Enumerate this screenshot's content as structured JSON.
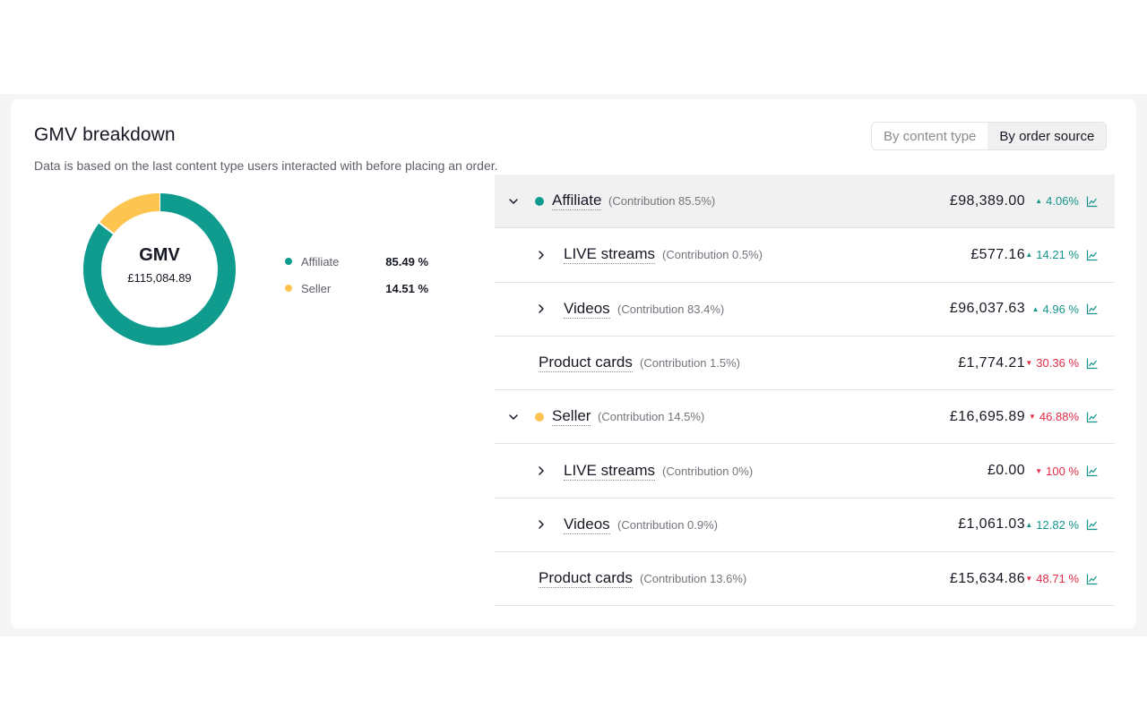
{
  "header": {
    "title": "GMV breakdown",
    "subtitle": "Data is based on the last content type users interacted with before placing an order."
  },
  "toggle": {
    "options": [
      "By content type",
      "By order source"
    ],
    "selected": "By order source"
  },
  "colors": {
    "affiliate": "#0f9b8e",
    "seller": "#fec450",
    "up": "#14948b",
    "down": "#e22b47"
  },
  "donut": {
    "title": "GMV",
    "total": "£115,084.89"
  },
  "chart_data": {
    "type": "pie",
    "categories": [
      "Affiliate",
      "Seller"
    ],
    "values": [
      85.49,
      14.51
    ],
    "title": "GMV"
  },
  "legend": [
    {
      "label": "Affiliate",
      "pct": "85.49 %"
    },
    {
      "label": "Seller",
      "pct": "14.51 %"
    }
  ],
  "rows": [
    {
      "name": "Affiliate",
      "contribution": "(Contribution 85.5%)",
      "amount": "£98,389.00",
      "change": "4.06%",
      "dir": "up",
      "level": 0,
      "expand": "down",
      "dot": "affiliate"
    },
    {
      "name": "LIVE streams",
      "contribution": "(Contribution 0.5%)",
      "amount": "£577.16",
      "change": "14.21 %",
      "dir": "up",
      "level": 1,
      "expand": "right"
    },
    {
      "name": "Videos",
      "contribution": "(Contribution 83.4%)",
      "amount": "£96,037.63",
      "change": "4.96 %",
      "dir": "up",
      "level": 1,
      "expand": "right"
    },
    {
      "name": "Product cards",
      "contribution": "(Contribution 1.5%)",
      "amount": "£1,774.21",
      "change": "30.36 %",
      "dir": "down",
      "level": 1,
      "expand": "none"
    },
    {
      "name": "Seller",
      "contribution": "(Contribution 14.5%)",
      "amount": "£16,695.89",
      "change": "46.88%",
      "dir": "down",
      "level": 0,
      "expand": "down",
      "dot": "seller"
    },
    {
      "name": "LIVE streams",
      "contribution": "(Contribution 0%)",
      "amount": "£0.00",
      "change": "100 %",
      "dir": "down",
      "level": 1,
      "expand": "right"
    },
    {
      "name": "Videos",
      "contribution": "(Contribution 0.9%)",
      "amount": "£1,061.03",
      "change": "12.82 %",
      "dir": "up",
      "level": 1,
      "expand": "right"
    },
    {
      "name": "Product cards",
      "contribution": "(Contribution 13.6%)",
      "amount": "£15,634.86",
      "change": "48.71 %",
      "dir": "down",
      "level": 1,
      "expand": "none"
    }
  ]
}
